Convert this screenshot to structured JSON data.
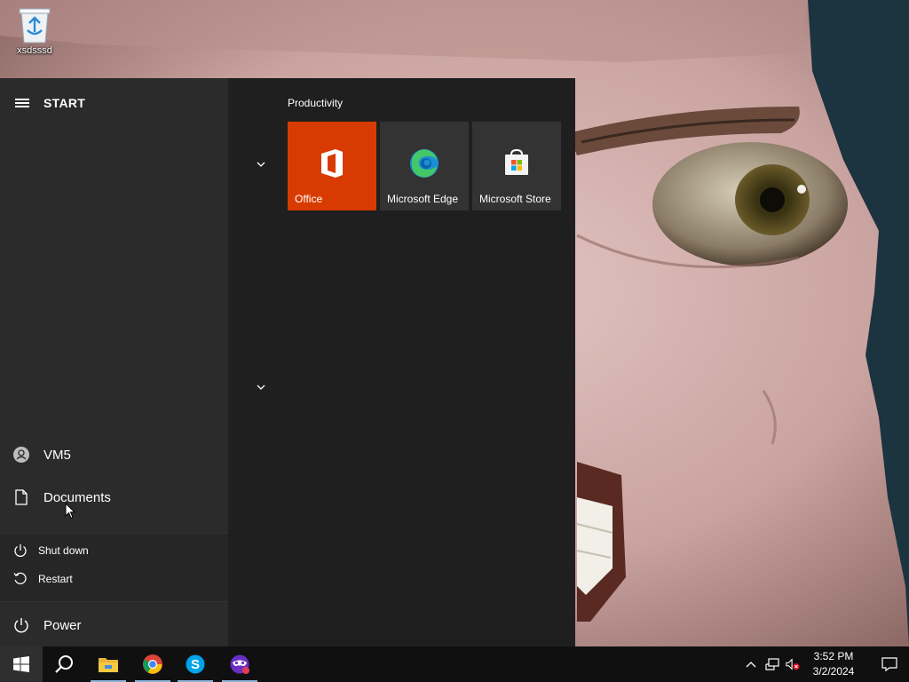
{
  "desktop": {
    "icons": [
      {
        "name": "recycle-bin",
        "label": "xsdsssd"
      }
    ]
  },
  "start_menu": {
    "title": "START",
    "left_items": [
      {
        "label": "VM5",
        "icon": "user-icon"
      },
      {
        "label": "Documents",
        "icon": "document-icon"
      }
    ],
    "power_flyout": [
      {
        "label": "Shut down",
        "icon": "power-icon"
      },
      {
        "label": "Restart",
        "icon": "restart-icon"
      }
    ],
    "power_label": "Power",
    "group_title": "Productivity",
    "tiles": [
      {
        "label": "Office",
        "icon": "office-icon",
        "color": "#d83b01"
      },
      {
        "label": "Microsoft Edge",
        "icon": "edge-icon",
        "color": "#333333"
      },
      {
        "label": "Microsoft Store",
        "icon": "store-icon",
        "color": "#333333"
      }
    ]
  },
  "taskbar": {
    "pinned": [
      {
        "name": "start",
        "icon": "windows-icon"
      },
      {
        "name": "search",
        "icon": "search-icon"
      },
      {
        "name": "file-explorer",
        "icon": "folder-icon"
      },
      {
        "name": "chrome",
        "icon": "chrome-icon"
      },
      {
        "name": "skype",
        "icon": "skype-icon"
      },
      {
        "name": "incognito-app",
        "icon": "mask-icon"
      }
    ],
    "tray": {
      "time": "3:52 PM",
      "date": "3/2/2024"
    }
  }
}
